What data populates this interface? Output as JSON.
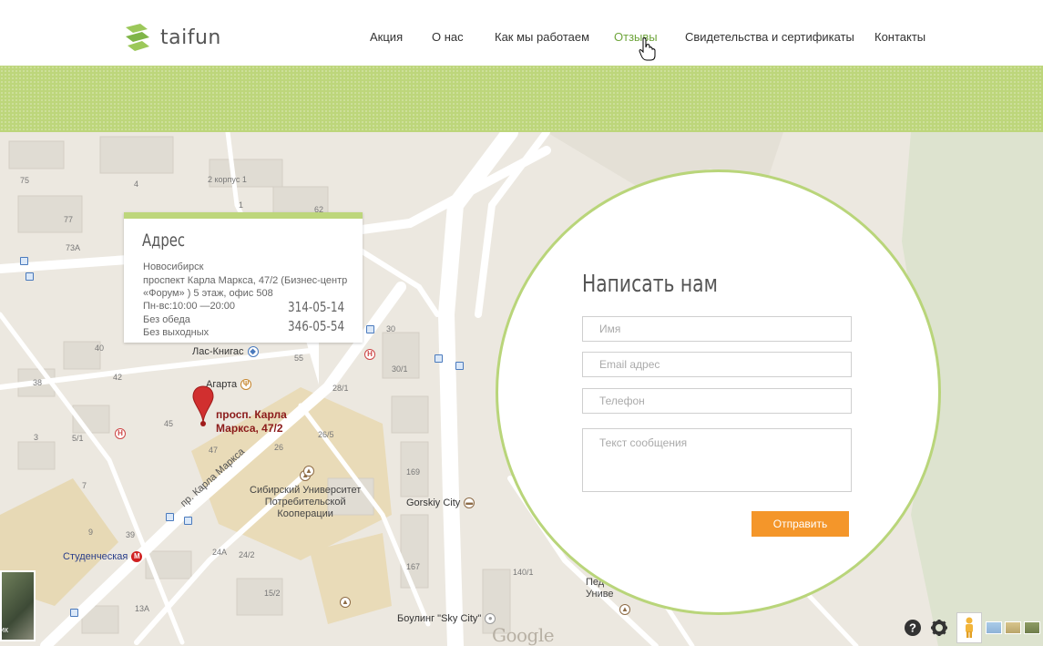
{
  "header": {
    "logo_text": "taifun",
    "nav": [
      {
        "label": "Акция",
        "active": false
      },
      {
        "label": "О нас",
        "active": false
      },
      {
        "label": "Как мы работаем",
        "active": false
      },
      {
        "label": "Отзывы",
        "active": true
      },
      {
        "label": "Свидетельства и сертификаты",
        "active": false
      },
      {
        "label": "Контакты",
        "active": false
      }
    ]
  },
  "colors": {
    "accent_green": "#bdd67b",
    "active_link": "#6fa53c",
    "button_orange": "#f4962a",
    "marker_red": "#d12f2f"
  },
  "address": {
    "title": "Адрес",
    "lines": [
      "Новосибирск",
      "проспект Карла Маркса, 47/2 (Бизнес-центр",
      "«Форум» ) 5 этаж, офис 508",
      "Пн-вс:10:00 —20:00",
      "Без обеда",
      "Без выходных"
    ],
    "phones": [
      "314-05-14",
      "346-05-54"
    ]
  },
  "map": {
    "marker_label_line1": "просп. Карла",
    "marker_label_line2": "Маркса, 47/2",
    "street_label": "пр. Карла Маркса",
    "places": {
      "las_knigas": "Лас-Книгас",
      "agarta": "Агарта",
      "university": [
        "Сибирский Университет",
        "Потребительской",
        "Кооперации"
      ],
      "gorskiy": "Gorskiy City",
      "studencheskaya": "Студенческая",
      "bowling": "Боулинг \"Sky City\"",
      "ped_partial": [
        "Пед",
        "Униве"
      ],
      "corpus": "2 корпус 1",
      "satellite": "ик"
    },
    "numbers": [
      "75",
      "4",
      "62",
      "1",
      "77",
      "73А",
      "40",
      "42",
      "38",
      "5/1",
      "3",
      "7",
      "9",
      "39",
      "45",
      "47",
      "55",
      "28/1",
      "26",
      "26/5",
      "169",
      "167",
      "140/1",
      "24А",
      "24/2",
      "15/2",
      "13А",
      "30",
      "30/1"
    ],
    "google": "Google"
  },
  "form": {
    "title": "Написать нам",
    "name_placeholder": "Имя",
    "email_placeholder": "Email адрес",
    "phone_placeholder": "Телефон",
    "message_placeholder": "Текст сообщения",
    "submit_label": "Отправить"
  }
}
